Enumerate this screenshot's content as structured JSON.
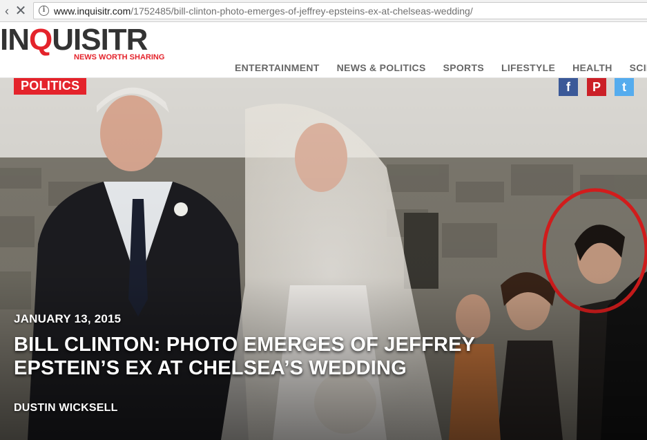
{
  "browser": {
    "back_icon": "back-arrow-icon",
    "stop_icon": "close-icon",
    "info_icon": "info-icon",
    "url_host": "www.inquisitr.com",
    "url_path": "/1752485/bill-clinton-photo-emerges-of-jeffrey-epsteins-ex-at-chelseas-wedding/"
  },
  "header": {
    "logo_part1": "IN",
    "logo_q": "Q",
    "logo_part2": "UISITR",
    "tagline": "NEWS WORTH SHARING",
    "nav": [
      "ENTERTAINMENT",
      "NEWS & POLITICS",
      "SPORTS",
      "LIFESTYLE",
      "HEALTH",
      "SCIE"
    ]
  },
  "article": {
    "category": "POLITICS",
    "date": "JANUARY 13, 2015",
    "title": "BILL CLINTON: PHOTO EMERGES OF JEFFREY EPSTEIN’S EX AT CHELSEA’S WEDDING",
    "author": "DUSTIN WICKSELL"
  },
  "social": {
    "facebook": "f",
    "pinterest": "P",
    "twitter": "t"
  },
  "colors": {
    "brand_red": "#e4232b",
    "facebook": "#3b5998",
    "pinterest": "#cb2027",
    "twitter": "#55acee"
  }
}
